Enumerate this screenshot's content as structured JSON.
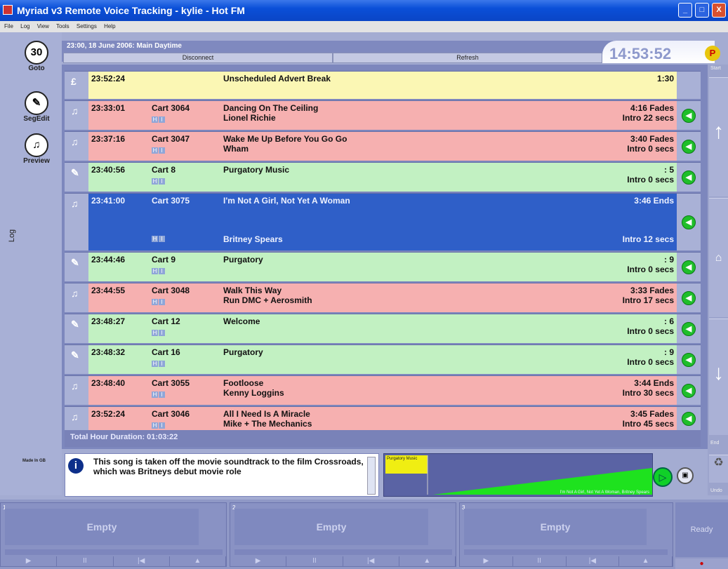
{
  "window": {
    "title": "Myriad v3 Remote Voice Tracking - kylie - Hot FM"
  },
  "menu": [
    "File",
    "Log",
    "View",
    "Tools",
    "Settings",
    "Help"
  ],
  "left": {
    "goto": "Goto",
    "goto_icon_text": "30",
    "segedit": "SegEdit",
    "preview": "Preview",
    "log_tab": "Log",
    "made_in": "Made In GB"
  },
  "header": {
    "subtitle": "23:00, 18 June 2006: Main Daytime",
    "disconnect": "Disconnect",
    "refresh": "Refresh",
    "clock": "14:53:52",
    "logo": "P"
  },
  "right": {
    "start": "Start",
    "end": "End",
    "undo": "Undo"
  },
  "rows": [
    {
      "time": "23:52:24",
      "cart": "",
      "title": "Unscheduled Advert Break",
      "artist": "",
      "dur": "1:30",
      "intro": "",
      "color": "#fbf7b4"
    },
    {
      "time": "23:33:01",
      "cart": "Cart 3064",
      "title": "Dancing On The Ceiling",
      "artist": "Lionel Richie",
      "dur": "4:16 Fades",
      "intro": "Intro 22 secs",
      "color": "#f6b0b0"
    },
    {
      "time": "23:37:16",
      "cart": "Cart 3047",
      "title": "Wake Me Up Before You Go Go",
      "artist": "Wham",
      "dur": "3:40 Fades",
      "intro": "Intro  0 secs",
      "color": "#f6b0b0"
    },
    {
      "time": "23:40:56",
      "cart": "Cart 8",
      "title": "Purgatory Music",
      "artist": "",
      "dur": ": 5",
      "intro": "Intro  0 secs",
      "color": "#c2f1c2"
    },
    {
      "time": "23:41:00",
      "cart": "Cart 3075",
      "title": "I'm Not A Girl, Not Yet A Woman",
      "artist": "Britney Spears",
      "dur": "3:46 Ends",
      "intro": "Intro 12 secs",
      "color": "#2f5fc8"
    },
    {
      "time": "23:44:46",
      "cart": "Cart 9",
      "title": "Purgatory",
      "artist": "",
      "dur": ": 9",
      "intro": "Intro  0 secs",
      "color": "#c2f1c2"
    },
    {
      "time": "23:44:55",
      "cart": "Cart 3048",
      "title": "Walk This Way",
      "artist": "Run DMC + Aerosmith",
      "dur": "3:33 Fades",
      "intro": "Intro 17 secs",
      "color": "#f6b0b0"
    },
    {
      "time": "23:48:27",
      "cart": "Cart 12",
      "title": "Welcome",
      "artist": "",
      "dur": ": 6",
      "intro": "Intro  0 secs",
      "color": "#c2f1c2"
    },
    {
      "time": "23:48:32",
      "cart": "Cart 16",
      "title": "Purgatory",
      "artist": "",
      "dur": ": 9",
      "intro": "Intro  0 secs",
      "color": "#c2f1c2"
    },
    {
      "time": "23:48:40",
      "cart": "Cart 3055",
      "title": "Footloose",
      "artist": "Kenny Loggins",
      "dur": "3:44 Ends",
      "intro": "Intro 30 secs",
      "color": "#f6b0b0"
    },
    {
      "time": "23:52:24",
      "cart": "Cart 3046",
      "title": "All I Need Is A Miracle",
      "artist": "Mike + The Mechanics",
      "dur": "3:45 Fades",
      "intro": "Intro 45 secs",
      "color": "#f6b0b0"
    }
  ],
  "total": "Total Hour Duration: 01:03:22",
  "info": "This song is taken off the movie soundtrack to the film Crossroads, which was Britneys debut movie role",
  "wave": {
    "label1": "Purgatory Music",
    "label2": "I'm Not A Girl, Not Yet A Woman, Britney Spears"
  },
  "slots": [
    {
      "num": "1",
      "label": "Empty"
    },
    {
      "num": "2",
      "label": "Empty"
    },
    {
      "num": "3",
      "label": "Empty"
    }
  ],
  "ready": "Ready"
}
